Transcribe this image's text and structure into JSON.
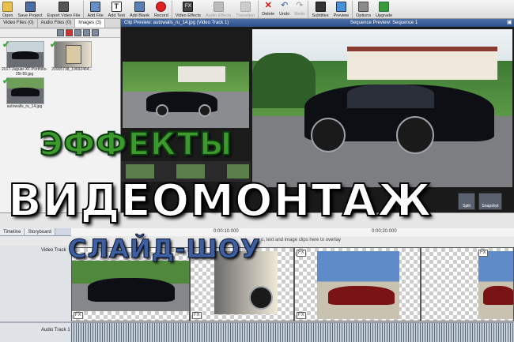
{
  "toolbar": {
    "open": "Open",
    "save_project": "Save Project",
    "export_video_file": "Export Video File",
    "add_file": "Add File",
    "add_text": "Add Text",
    "add_blank": "Add Blank",
    "record": "Record",
    "video_effects": "Video Effects",
    "audio_effects": "Audio Effects",
    "transition": "Transition",
    "delete": "Delete",
    "undo": "Undo",
    "redo": "Redo",
    "subtitles": "Subtitles",
    "preview": "Preview",
    "options": "Options",
    "upgrade": "Upgrade"
  },
  "bin": {
    "tabs": [
      "Video Files",
      "Audio Files",
      "Images"
    ],
    "tab_counts": [
      "(0)",
      "(3)"
    ],
    "items": [
      {
        "caption": "2017-Jaguar-XF-Portfolio-25t-55.jpg"
      },
      {
        "caption": "20905738_19692464..."
      },
      {
        "caption": "autowalls_ru_14.jpg"
      }
    ]
  },
  "clip_preview": {
    "title": "Clip Preview: autowalls_ru_14.jpg (Video Track 1)"
  },
  "sequence_preview": {
    "title": "Sequence Preview: Sequence 1"
  },
  "controls": {
    "split": "Split",
    "snapshot": "Snapshot"
  },
  "timeline": {
    "tabs": [
      "Timeline",
      "Storyboard"
    ],
    "ruler": [
      "0:00:10.000",
      "0:00:20.000"
    ],
    "overlay_hint": "o, text and image clips here to overlay",
    "video_track": "Video Track",
    "audio_track": "Audio Track 1",
    "fx_label": "FX"
  },
  "overlay": {
    "line1": "ЭФФЕКТЫ",
    "line2": "ВИДЕОМОНТАЖ",
    "line3": "СЛАЙД-ШОУ"
  },
  "colors": {
    "effects_green": "#3c9a2c",
    "slideshow_blue": "#3e5fa0",
    "header_blue": "#2e4f86"
  }
}
